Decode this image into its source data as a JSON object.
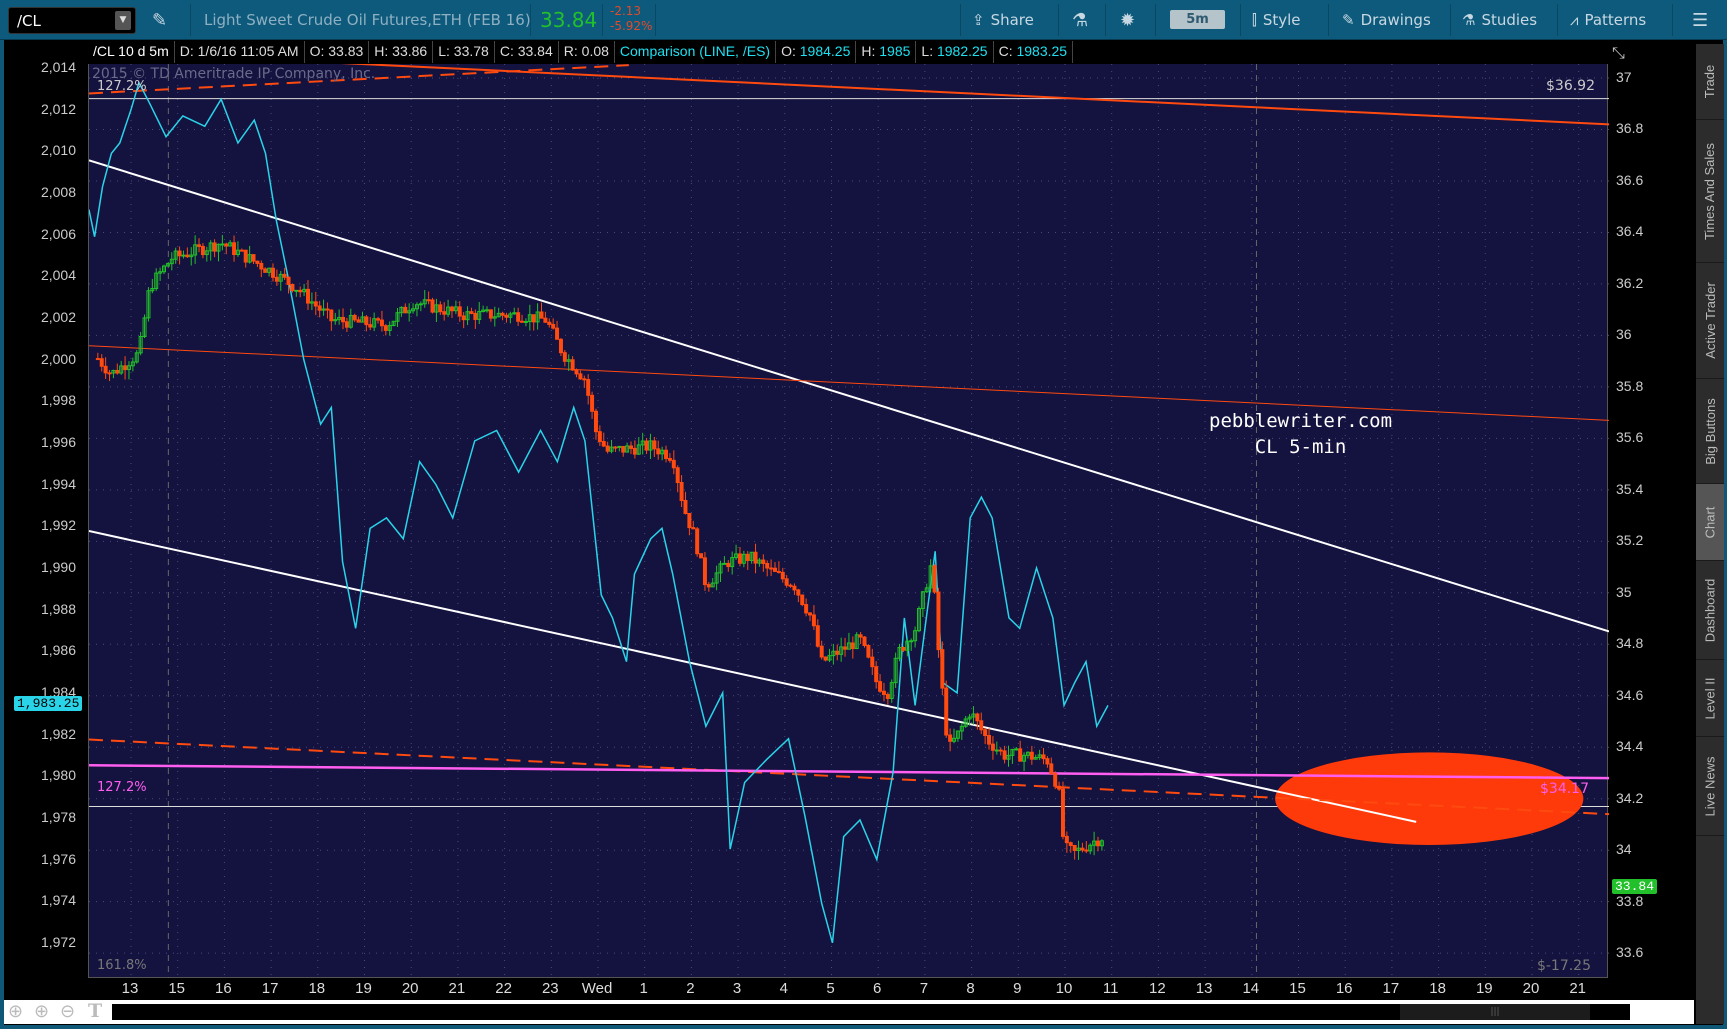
{
  "toolbar": {
    "symbol": "/CL",
    "description": "Light Sweet Crude Oil Futures,ETH (FEB 16)",
    "last": "33.84",
    "change": "-2.13",
    "change_pct": "-5.92%",
    "share": "Share",
    "interval": "5m",
    "style": "Style",
    "drawings": "Drawings",
    "studies": "Studies",
    "patterns": "Patterns"
  },
  "infobar": {
    "study": "/CL 10 d 5m",
    "date": "D: 1/6/16 11:05 AM",
    "open": "O: 33.83",
    "high": "H: 33.86",
    "low": "L: 33.78",
    "close": "C: 33.84",
    "range": "R: 0.08",
    "comparison": "Comparison (LINE, /ES)",
    "c_open_label": "O:",
    "c_open": "1984.25",
    "c_high_label": "H:",
    "c_high": "1985",
    "c_low_label": "L:",
    "c_low": "1982.25",
    "c_close_label": "C:",
    "c_close": "1983.25"
  },
  "chart": {
    "copyright": "2015 © TD Ameritrade IP Company, Inc.",
    "fib_top": "127.2%",
    "fib_mid": "127.2%",
    "fib_bottom": "161.8%",
    "level_top": "$36.92",
    "level_mid": "$34.17",
    "level_bottom": "$-17.25",
    "watermark1": "pebblewriter.com",
    "watermark2": "CL 5-min",
    "es_badge": "1,983.25",
    "cl_badge": "33.84"
  },
  "sidebar": [
    "Trade",
    "Times And Sales",
    "Active Trader",
    "Big Buttons",
    "Chart",
    "Dashboard",
    "Level II",
    "Live News"
  ],
  "colors": {
    "up": "#22c02a",
    "down": "#ff4a10",
    "es": "#2ad4e8",
    "trend": "#ffffff",
    "orange": "#ff4a10",
    "magenta": "#ff5ef0"
  },
  "chart_data": {
    "type": "line",
    "title": "/CL 10 d 5m",
    "x_ticks": [
      "13",
      "15",
      "16",
      "17",
      "18",
      "19",
      "20",
      "21",
      "22",
      "23",
      "Wed",
      "1",
      "2",
      "3",
      "4",
      "5",
      "6",
      "7",
      "8",
      "9",
      "10",
      "11",
      "12",
      "13",
      "14",
      "15",
      "16",
      "17",
      "18",
      "19",
      "20",
      "21"
    ],
    "right_axis": {
      "ticks": [
        "37",
        "36.8",
        "36.6",
        "36.4",
        "36.2",
        "36",
        "35.8",
        "35.6",
        "35.4",
        "35.2",
        "35",
        "34.8",
        "34.6",
        "34.4",
        "34.2",
        "34",
        "33.8",
        "33.6"
      ]
    },
    "left_axis": {
      "ticks": [
        "2,014",
        "2,012",
        "2,010",
        "2,008",
        "2,006",
        "2,004",
        "2,002",
        "2,000",
        "1,998",
        "1,996",
        "1,994",
        "1,992",
        "1,990",
        "1,988",
        "1,986",
        "1,984",
        "1,982",
        "1,980",
        "1,978",
        "1,976",
        "1,974",
        "1,972"
      ]
    },
    "cl_close": [
      [
        -0.71,
        35.91
      ],
      [
        -0.42,
        35.85
      ],
      [
        0.17,
        35.93
      ],
      [
        0.4,
        36.19
      ],
      [
        0.87,
        36.3
      ],
      [
        1.93,
        36.36
      ],
      [
        3.0,
        36.25
      ],
      [
        3.58,
        36.18
      ],
      [
        4.29,
        36.06
      ],
      [
        5.47,
        36.04
      ],
      [
        6.06,
        36.13
      ],
      [
        7.12,
        36.08
      ],
      [
        8.3,
        36.08
      ],
      [
        8.89,
        36.06
      ],
      [
        9.25,
        35.93
      ],
      [
        9.72,
        35.83
      ],
      [
        9.95,
        35.63
      ],
      [
        10.19,
        35.55
      ],
      [
        11.13,
        35.57
      ],
      [
        11.6,
        35.53
      ],
      [
        11.84,
        35.33
      ],
      [
        12.08,
        35.21
      ],
      [
        12.31,
        35.03
      ],
      [
        12.78,
        35.12
      ],
      [
        13.25,
        35.14
      ],
      [
        13.73,
        35.08
      ],
      [
        14.2,
        35.03
      ],
      [
        14.55,
        34.91
      ],
      [
        14.79,
        34.73
      ],
      [
        15.14,
        34.77
      ],
      [
        15.61,
        34.82
      ],
      [
        15.97,
        34.65
      ],
      [
        16.2,
        34.61
      ],
      [
        16.44,
        34.77
      ],
      [
        16.79,
        34.86
      ],
      [
        17.15,
        35.12
      ],
      [
        17.31,
        34.73
      ],
      [
        17.5,
        34.39
      ],
      [
        17.74,
        34.46
      ],
      [
        17.97,
        34.54
      ],
      [
        18.33,
        34.43
      ],
      [
        18.68,
        34.37
      ],
      [
        19.15,
        34.37
      ],
      [
        19.62,
        34.35
      ],
      [
        19.86,
        34.24
      ],
      [
        19.98,
        34.01
      ],
      [
        20.21,
        33.99
      ],
      [
        20.57,
        34.03
      ],
      [
        20.8,
        34.05
      ],
      [
        20.87,
        33.84
      ]
    ],
    "es_line": [
      [
        -0.9,
        2007.2
      ],
      [
        -0.78,
        2005.9
      ],
      [
        -0.61,
        2008.3
      ],
      [
        -0.42,
        2009.9
      ],
      [
        -0.24,
        2010.4
      ],
      [
        0,
        2012.0
      ],
      [
        0.17,
        2013.3
      ],
      [
        0.4,
        2012.3
      ],
      [
        0.75,
        2010.7
      ],
      [
        1.11,
        2011.7
      ],
      [
        1.58,
        2011.2
      ],
      [
        1.93,
        2012.5
      ],
      [
        2.29,
        2010.4
      ],
      [
        2.64,
        2011.5
      ],
      [
        2.88,
        2009.9
      ],
      [
        3.11,
        2006.7
      ],
      [
        3.35,
        2004.1
      ],
      [
        3.7,
        2000.0
      ],
      [
        4.06,
        1996.9
      ],
      [
        4.29,
        1997.7
      ],
      [
        4.53,
        1990.3
      ],
      [
        4.81,
        1987.1
      ],
      [
        5.12,
        1991.9
      ],
      [
        5.47,
        1992.4
      ],
      [
        5.83,
        1991.4
      ],
      [
        6.18,
        1995.1
      ],
      [
        6.53,
        1994.0
      ],
      [
        6.89,
        1992.4
      ],
      [
        7.36,
        1996.1
      ],
      [
        7.83,
        1996.6
      ],
      [
        8.3,
        1994.6
      ],
      [
        8.77,
        1996.6
      ],
      [
        9.13,
        1995.1
      ],
      [
        9.48,
        1997.7
      ],
      [
        9.72,
        1996.1
      ],
      [
        10.07,
        1988.7
      ],
      [
        10.31,
        1987.6
      ],
      [
        10.61,
        1985.5
      ],
      [
        10.78,
        1989.7
      ],
      [
        11.13,
        1991.4
      ],
      [
        11.37,
        1991.9
      ],
      [
        11.6,
        1989.7
      ],
      [
        11.96,
        1985.5
      ],
      [
        12.31,
        1982.4
      ],
      [
        12.67,
        1984.0
      ],
      [
        12.83,
        1976.5
      ],
      [
        13.14,
        1979.7
      ],
      [
        13.61,
        1980.8
      ],
      [
        14.08,
        1981.8
      ],
      [
        14.43,
        1978.1
      ],
      [
        14.79,
        1973.9
      ],
      [
        15.02,
        1972.0
      ],
      [
        15.26,
        1977.1
      ],
      [
        15.61,
        1977.9
      ],
      [
        15.97,
        1976.0
      ],
      [
        16.32,
        1980.2
      ],
      [
        16.56,
        1987.6
      ],
      [
        16.79,
        1983.4
      ],
      [
        17.03,
        1987.6
      ],
      [
        17.22,
        1990.8
      ],
      [
        17.38,
        1984.5
      ],
      [
        17.69,
        1984.0
      ],
      [
        17.97,
        1992.4
      ],
      [
        18.21,
        1993.4
      ],
      [
        18.44,
        1992.4
      ],
      [
        18.8,
        1987.6
      ],
      [
        19.03,
        1987.1
      ],
      [
        19.39,
        1990.0
      ],
      [
        19.74,
        1987.6
      ],
      [
        19.98,
        1983.4
      ],
      [
        20.21,
        1984.5
      ],
      [
        20.45,
        1985.5
      ],
      [
        20.68,
        1982.4
      ],
      [
        20.92,
        1983.4
      ]
    ],
    "trendlines": [
      {
        "name": "upper-channel",
        "color": "white",
        "dash": false,
        "from": [
          -0.9,
          36.68
        ],
        "to": [
          31.65,
          34.85
        ]
      },
      {
        "name": "lower-channel",
        "color": "white",
        "dash": false,
        "from": [
          -0.9,
          35.24
        ],
        "to": [
          27.52,
          34.11
        ]
      },
      {
        "name": "orange-mid",
        "color": "orange",
        "dash": false,
        "from": [
          -0.9,
          35.96
        ],
        "to": [
          31.65,
          35.67
        ]
      },
      {
        "name": "orange-top",
        "color": "orange",
        "dash": false,
        "from": [
          4.29,
          37.06
        ],
        "to": [
          31.65,
          36.82
        ]
      },
      {
        "name": "orange-top-dashed",
        "color": "orange",
        "dash": true,
        "from": [
          -0.9,
          36.94
        ],
        "to": [
          10.66,
          37.05
        ]
      },
      {
        "name": "orange-low-dashed",
        "color": "orange",
        "dash": true,
        "from": [
          -0.9,
          34.43
        ],
        "to": [
          31.65,
          34.14
        ]
      },
      {
        "name": "magenta-line",
        "color": "magenta",
        "dash": false,
        "from": [
          -0.9,
          34.33
        ],
        "to": [
          31.65,
          34.28
        ]
      }
    ],
    "horizontal_levels": [
      36.92,
      34.17
    ],
    "target_ellipse": {
      "center": [
        27.8,
        34.2
      ],
      "rx_hours": 3.3,
      "ry_price": 0.18
    },
    "day_separators": [
      0.8,
      24.1
    ]
  }
}
